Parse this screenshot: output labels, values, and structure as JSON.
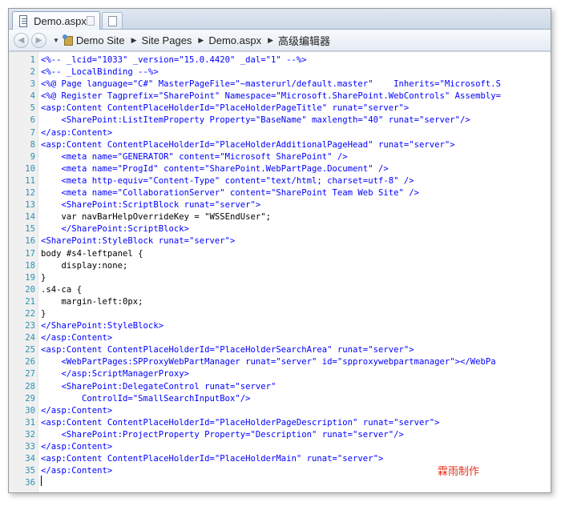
{
  "tab": {
    "title": "Demo.aspx"
  },
  "breadcrumb": {
    "root": "Demo Site",
    "items": [
      "Site Pages",
      "Demo.aspx",
      "高级编辑器"
    ]
  },
  "editor": {
    "lines": [
      {
        "n": "1",
        "text": "<%-- _lcid=\"1033\" _version=\"15.0.4420\" _dal=\"1\" --%>",
        "kind": "markup"
      },
      {
        "n": "2",
        "text": "<%-- _LocalBinding --%>",
        "kind": "markup"
      },
      {
        "n": "3",
        "text": "<%@ Page language=\"C#\" MasterPageFile=\"~masterurl/default.master\"    Inherits=\"Microsoft.S",
        "kind": "markup"
      },
      {
        "n": "4",
        "text": "<%@ Register Tagprefix=\"SharePoint\" Namespace=\"Microsoft.SharePoint.WebControls\" Assembly=",
        "kind": "markup"
      },
      {
        "n": "5",
        "text": "<asp:Content ContentPlaceHolderId=\"PlaceHolderPageTitle\" runat=\"server\">",
        "kind": "markup"
      },
      {
        "n": "6",
        "text": "    <SharePoint:ListItemProperty Property=\"BaseName\" maxlength=\"40\" runat=\"server\"/>",
        "kind": "markup"
      },
      {
        "n": "7",
        "text": "</asp:Content>",
        "kind": "markup"
      },
      {
        "n": "8",
        "text": "<asp:Content ContentPlaceHolderId=\"PlaceHolderAdditionalPageHead\" runat=\"server\">",
        "kind": "markup"
      },
      {
        "n": "9",
        "text": "    <meta name=\"GENERATOR\" content=\"Microsoft SharePoint\" />",
        "kind": "markup"
      },
      {
        "n": "10",
        "text": "    <meta name=\"ProgId\" content=\"SharePoint.WebPartPage.Document\" />",
        "kind": "markup"
      },
      {
        "n": "11",
        "text": "    <meta http-equiv=\"Content-Type\" content=\"text/html; charset=utf-8\" />",
        "kind": "markup"
      },
      {
        "n": "12",
        "text": "    <meta name=\"CollaborationServer\" content=\"SharePoint Team Web Site\" />",
        "kind": "markup"
      },
      {
        "n": "13",
        "text": "    <SharePoint:ScriptBlock runat=\"server\">",
        "kind": "markup"
      },
      {
        "n": "14",
        "text": "    var navBarHelpOverrideKey = \"WSSEndUser\";",
        "kind": "text"
      },
      {
        "n": "15",
        "text": "    </SharePoint:ScriptBlock>",
        "kind": "markup"
      },
      {
        "n": "16",
        "text": "<SharePoint:StyleBlock runat=\"server\">",
        "kind": "markup"
      },
      {
        "n": "17",
        "text": "body #s4-leftpanel {",
        "kind": "text"
      },
      {
        "n": "18",
        "text": "    display:none;",
        "kind": "text"
      },
      {
        "n": "19",
        "text": "}",
        "kind": "text"
      },
      {
        "n": "20",
        "text": ".s4-ca {",
        "kind": "text"
      },
      {
        "n": "21",
        "text": "    margin-left:0px;",
        "kind": "text"
      },
      {
        "n": "22",
        "text": "}",
        "kind": "text"
      },
      {
        "n": "23",
        "text": "</SharePoint:StyleBlock>",
        "kind": "markup"
      },
      {
        "n": "24",
        "text": "</asp:Content>",
        "kind": "markup"
      },
      {
        "n": "25",
        "text": "<asp:Content ContentPlaceHolderId=\"PlaceHolderSearchArea\" runat=\"server\">",
        "kind": "markup"
      },
      {
        "n": "26",
        "text": "    <WebPartPages:SPProxyWebPartManager runat=\"server\" id=\"spproxywebpartmanager\"></WebPa",
        "kind": "markup"
      },
      {
        "n": "27",
        "text": "    </asp:ScriptManagerProxy>",
        "kind": "markup"
      },
      {
        "n": "28",
        "text": "    <SharePoint:DelegateControl runat=\"server\"",
        "kind": "markup"
      },
      {
        "n": "29",
        "text": "        ControlId=\"SmallSearchInputBox\"/>",
        "kind": "markup"
      },
      {
        "n": "30",
        "text": "</asp:Content>",
        "kind": "markup"
      },
      {
        "n": "31",
        "text": "<asp:Content ContentPlaceHolderId=\"PlaceHolderPageDescription\" runat=\"server\">",
        "kind": "markup"
      },
      {
        "n": "32",
        "text": "    <SharePoint:ProjectProperty Property=\"Description\" runat=\"server\"/>",
        "kind": "markup"
      },
      {
        "n": "33",
        "text": "</asp:Content>",
        "kind": "markup"
      },
      {
        "n": "34",
        "text": "<asp:Content ContentPlaceHolderId=\"PlaceHolderMain\" runat=\"server\">",
        "kind": "markup"
      },
      {
        "n": "35",
        "text": "</asp:Content>",
        "kind": "markup"
      },
      {
        "n": "36",
        "text": "",
        "kind": "text"
      }
    ],
    "watermark": "霖雨制作"
  }
}
